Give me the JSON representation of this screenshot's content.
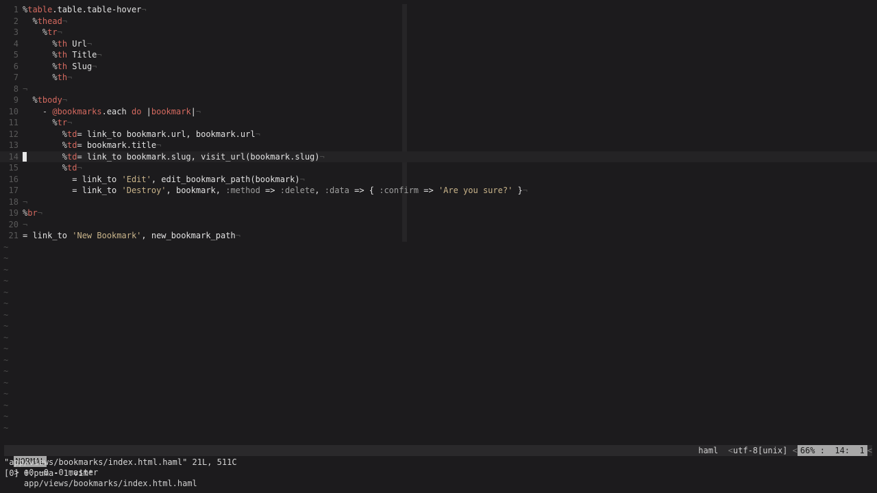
{
  "editor": {
    "lines": [
      {
        "n": "1",
        "tokens": [
          {
            "c": "t-pct",
            "t": "%"
          },
          {
            "c": "t-tag",
            "t": "table"
          },
          {
            "c": "code",
            "t": ".table.table-hover"
          },
          {
            "c": "t-nl",
            "t": "¬"
          }
        ]
      },
      {
        "n": "2",
        "tokens": [
          {
            "c": "code",
            "t": "  "
          },
          {
            "c": "t-pct",
            "t": "%"
          },
          {
            "c": "t-tag",
            "t": "thead"
          },
          {
            "c": "t-nl",
            "t": "¬"
          }
        ]
      },
      {
        "n": "3",
        "tokens": [
          {
            "c": "code",
            "t": "    "
          },
          {
            "c": "t-pct",
            "t": "%"
          },
          {
            "c": "t-tag",
            "t": "tr"
          },
          {
            "c": "t-nl",
            "t": "¬"
          }
        ]
      },
      {
        "n": "4",
        "tokens": [
          {
            "c": "code",
            "t": "      "
          },
          {
            "c": "t-pct",
            "t": "%"
          },
          {
            "c": "t-tag",
            "t": "th"
          },
          {
            "c": "code",
            "t": " Url"
          },
          {
            "c": "t-nl",
            "t": "¬"
          }
        ]
      },
      {
        "n": "5",
        "tokens": [
          {
            "c": "code",
            "t": "      "
          },
          {
            "c": "t-pct",
            "t": "%"
          },
          {
            "c": "t-tag",
            "t": "th"
          },
          {
            "c": "code",
            "t": " Title"
          },
          {
            "c": "t-nl",
            "t": "¬"
          }
        ]
      },
      {
        "n": "6",
        "tokens": [
          {
            "c": "code",
            "t": "      "
          },
          {
            "c": "t-pct",
            "t": "%"
          },
          {
            "c": "t-tag",
            "t": "th"
          },
          {
            "c": "code",
            "t": " Slug"
          },
          {
            "c": "t-nl",
            "t": "¬"
          }
        ]
      },
      {
        "n": "7",
        "tokens": [
          {
            "c": "code",
            "t": "      "
          },
          {
            "c": "t-pct",
            "t": "%"
          },
          {
            "c": "t-tag",
            "t": "th"
          },
          {
            "c": "t-nl",
            "t": "¬"
          }
        ]
      },
      {
        "n": "8",
        "tokens": [
          {
            "c": "t-nl",
            "t": "¬"
          }
        ]
      },
      {
        "n": "9",
        "tokens": [
          {
            "c": "code",
            "t": "  "
          },
          {
            "c": "t-pct",
            "t": "%"
          },
          {
            "c": "t-tag",
            "t": "tbody"
          },
          {
            "c": "t-nl",
            "t": "¬"
          }
        ]
      },
      {
        "n": "10",
        "tokens": [
          {
            "c": "code",
            "t": "    "
          },
          {
            "c": "t-op",
            "t": "- "
          },
          {
            "c": "t-var",
            "t": "@bookmarks"
          },
          {
            "c": "code",
            "t": ".each "
          },
          {
            "c": "t-kw",
            "t": "do"
          },
          {
            "c": "code",
            "t": " |"
          },
          {
            "c": "t-var",
            "t": "bookmark"
          },
          {
            "c": "code",
            "t": "|"
          },
          {
            "c": "t-nl",
            "t": "¬"
          }
        ]
      },
      {
        "n": "11",
        "tokens": [
          {
            "c": "code",
            "t": "      "
          },
          {
            "c": "t-pct",
            "t": "%"
          },
          {
            "c": "t-tag",
            "t": "tr"
          },
          {
            "c": "t-nl",
            "t": "¬"
          }
        ]
      },
      {
        "n": "12",
        "tokens": [
          {
            "c": "code",
            "t": "        "
          },
          {
            "c": "t-pct",
            "t": "%"
          },
          {
            "c": "t-tag",
            "t": "td"
          },
          {
            "c": "code",
            "t": "= link_to bookmark.url, bookmark.url"
          },
          {
            "c": "t-nl",
            "t": "¬"
          }
        ]
      },
      {
        "n": "13",
        "tokens": [
          {
            "c": "code",
            "t": "        "
          },
          {
            "c": "t-pct",
            "t": "%"
          },
          {
            "c": "t-tag",
            "t": "td"
          },
          {
            "c": "code",
            "t": "= bookmark.title"
          },
          {
            "c": "t-nl",
            "t": "¬"
          }
        ]
      },
      {
        "n": "14",
        "cursor": true,
        "tokens": [
          {
            "c": "code",
            "t": "        "
          },
          {
            "c": "t-pct",
            "t": "%"
          },
          {
            "c": "t-tag",
            "t": "td"
          },
          {
            "c": "code",
            "t": "= link_to bookmark.slug, visit_url(bookmark.slug)"
          },
          {
            "c": "t-nl",
            "t": "¬"
          }
        ]
      },
      {
        "n": "15",
        "tokens": [
          {
            "c": "code",
            "t": "        "
          },
          {
            "c": "t-pct",
            "t": "%"
          },
          {
            "c": "t-tag",
            "t": "td"
          },
          {
            "c": "t-nl",
            "t": "¬"
          }
        ]
      },
      {
        "n": "16",
        "tokens": [
          {
            "c": "code",
            "t": "          = link_to "
          },
          {
            "c": "t-str",
            "t": "'Edit'"
          },
          {
            "c": "code",
            "t": ", edit_bookmark_path(bookmark)"
          },
          {
            "c": "t-nl",
            "t": "¬"
          }
        ]
      },
      {
        "n": "17",
        "tokens": [
          {
            "c": "code",
            "t": "          = link_to "
          },
          {
            "c": "t-str",
            "t": "'Destroy'"
          },
          {
            "c": "code",
            "t": ", bookmark, "
          },
          {
            "c": "t-sym",
            "t": ":method"
          },
          {
            "c": "code",
            "t": " => "
          },
          {
            "c": "t-sym",
            "t": ":delete"
          },
          {
            "c": "code",
            "t": ", "
          },
          {
            "c": "t-sym",
            "t": ":data"
          },
          {
            "c": "code",
            "t": " => { "
          },
          {
            "c": "t-sym",
            "t": ":confirm"
          },
          {
            "c": "code",
            "t": " => "
          },
          {
            "c": "t-str",
            "t": "'Are you sure?'"
          },
          {
            "c": "code",
            "t": " }"
          },
          {
            "c": "t-nl",
            "t": "¬"
          }
        ]
      },
      {
        "n": "18",
        "tokens": [
          {
            "c": "t-nl",
            "t": "¬"
          }
        ]
      },
      {
        "n": "19",
        "tokens": [
          {
            "c": "t-pct",
            "t": "%"
          },
          {
            "c": "t-tag",
            "t": "br"
          },
          {
            "c": "t-nl",
            "t": "¬"
          }
        ]
      },
      {
        "n": "20",
        "tokens": [
          {
            "c": "t-nl",
            "t": "¬"
          }
        ]
      },
      {
        "n": "21",
        "tokens": [
          {
            "c": "code",
            "t": "= link_to "
          },
          {
            "c": "t-str",
            "t": "'New Bookmark'"
          },
          {
            "c": "code",
            "t": ", new_bookmark_path"
          },
          {
            "c": "t-nl",
            "t": "¬"
          }
        ]
      }
    ],
    "empty_line_marker": "~",
    "empty_line_count": 17
  },
  "statusbar": {
    "mode": "NORMAL",
    "git": "> +0 ~0 -0 master",
    "path": "app/views/bookmarks/index.html.haml",
    "filetype": "haml",
    "sep1": "<",
    "encoding": "utf-8[unix]",
    "sep2": "<",
    "position": "66% :  14:  1",
    "sep3": "<"
  },
  "message": "\"app/views/bookmarks/index.html.haml\" 21L, 511C",
  "tmux": "[0] 0:puma- 1:vim*"
}
